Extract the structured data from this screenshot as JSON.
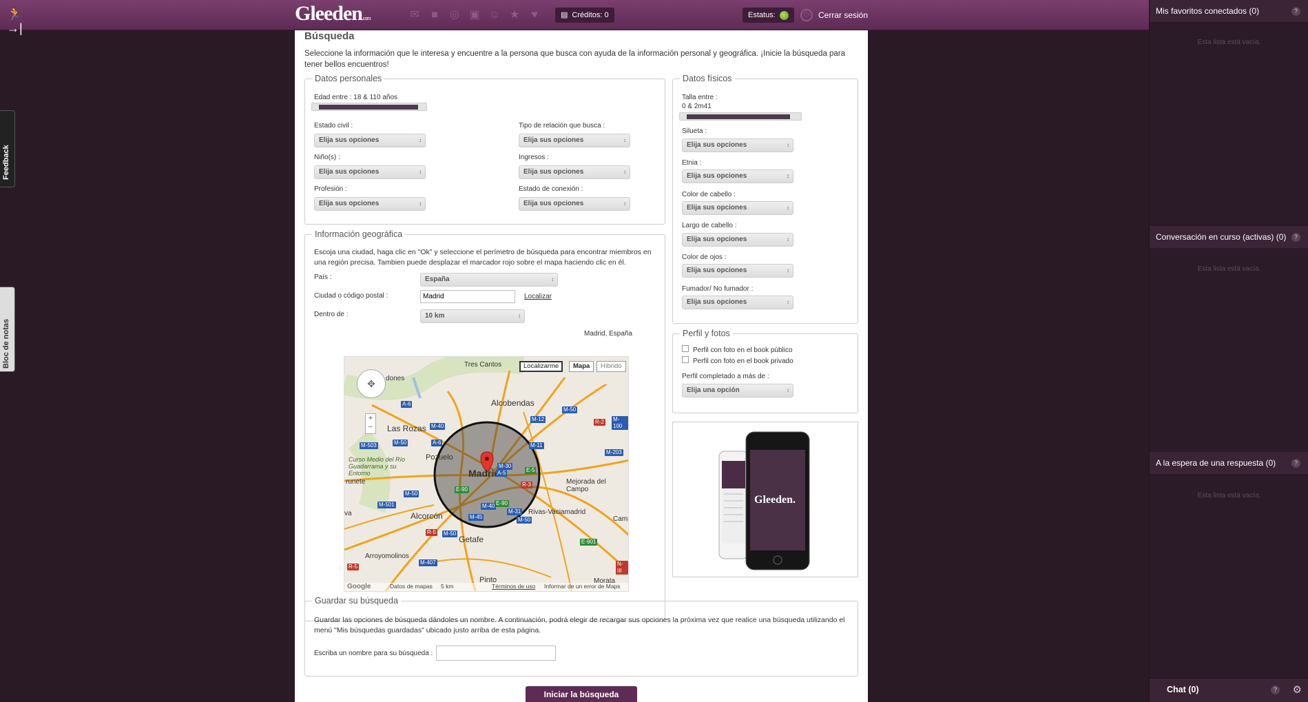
{
  "topbar": {
    "logo": "Gleeden",
    "logo_suffix": ".com",
    "credits_label": "Créditos: 0",
    "status_label": "Estatus:",
    "logout_label": "Cerrar sesión",
    "icons": [
      "mail-icon",
      "van-icon",
      "camera-icon",
      "gift-icon",
      "user-icon",
      "star-icon",
      "heart-icon"
    ]
  },
  "sidetabs": {
    "feedback": "Feedback",
    "notes": "Bloc de notas"
  },
  "main": {
    "title": "Búsqueda",
    "intro": "Seleccione la información que le interesa y encuentre a la persona que busca con ayuda de la información personal y geográfica. ¡Inicie la búsqueda para tener bellos encuentros!",
    "personal": {
      "legend": "Datos personales",
      "age_label": "Edad entre : 18 & 110 años",
      "age_range": [
        0.05,
        0.95
      ],
      "fields": [
        {
          "label": "Estado civil :",
          "value": "Elija sus opciones"
        },
        {
          "label": "Tipo de relación que busca :",
          "value": "Elija sus opciones"
        },
        {
          "label": "Niño(s) :",
          "value": "Elija sus opciones"
        },
        {
          "label": "Ingresos :",
          "value": "Elija sus opciones"
        },
        {
          "label": "Profesión :",
          "value": "Elija sus opciones"
        },
        {
          "label": "Estado de conexión :",
          "value": "Elija sus opciones"
        }
      ]
    },
    "geo": {
      "legend": "Información geográfica",
      "description": "Escoja una ciudad, haga clic en \"Ok\" y seleccione el perímetro de búsqueda para encontrar miembros en una región precisa. Tambien puede desplazar el marcador rojo sobre el mapa haciendo clic en él.",
      "country_label": "País :",
      "country_value": "España",
      "city_label": "Ciudad o código postal :",
      "city_value": "Madrid",
      "locate_link": "Localizar",
      "within_label": "Dentro de :",
      "within_value": "10 km",
      "location_text": "Madrid, España",
      "map": {
        "btn_locate": "Localizarme",
        "btn_map": "Mapa",
        "btn_hybrid": "Híbrido",
        "zoom_in": "+",
        "zoom_out": "−",
        "labels": [
          "Tres Cantos",
          "Alcobendas",
          "Las Rozas",
          "Pozuelo",
          "Madrid",
          "Alcorcón",
          "Getafe",
          "Mejorada del Campo",
          "Rivas-Vaciamadrid",
          "Arroyomolinos",
          "Pinto",
          "Morata",
          "Curso Medio del Río Guadarrama y su Entorno",
          "runete",
          "Camp",
          "va",
          "dones"
        ],
        "road_labels": [
          "A-6",
          "M-40",
          "M-12",
          "M-50",
          "R-2",
          "M-100",
          "M-503",
          "M-50",
          "A-6",
          "M-11",
          "M-203",
          "M-30",
          "E-5",
          "E-90",
          "M-50",
          "M-501",
          "E-90",
          "M-40",
          "M-31",
          "M-45",
          "M-50",
          "R-5",
          "M-50",
          "E-901",
          "M-407",
          "R-5",
          "N-III",
          "A-5",
          "R-3"
        ],
        "footer_data": "Datos de mapas",
        "footer_scale": "5 km",
        "footer_terms": "Términos de uso",
        "footer_report": "Informar de un error de Maps",
        "google": "Google"
      }
    },
    "physical": {
      "legend": "Datos físicos",
      "height_label": "Talla entre :",
      "height_value": "0 & 2m41",
      "height_range": [
        0.05,
        0.95
      ],
      "fields": [
        {
          "label": "Silueta :",
          "value": "Elija sus opciones"
        },
        {
          "label": "Etnia :",
          "value": "Elija sus opciones"
        },
        {
          "label": "Color de cabello :",
          "value": "Elija sus opciones"
        },
        {
          "label": "Largo de cabello :",
          "value": "Elija sus opciones"
        },
        {
          "label": "Color de ojos :",
          "value": "Elija sus opciones"
        },
        {
          "label": "Fumador/ No fumador :",
          "value": "Elija sus opciones"
        }
      ]
    },
    "profile": {
      "legend": "Perfil y fotos",
      "check_public": "Perfil con foto en el book público",
      "check_private": "Perfil con foto en el book privado",
      "completed_label": "Perfil completado a más de :",
      "completed_value": "Elija una opción"
    },
    "ad": {
      "brand": "Gleeden."
    },
    "save": {
      "legend": "Guardar su búsqueda",
      "description": "Guardar las opciones de búsqueda dándoles un nombre. A continuación, podrá elegir de recargar sus opciones la próxima vez que realice una búsqueda utilizando el menú \"Mis búsquedas guardadas\" ubicado justo arriba de esta página.",
      "name_label": "Escriba un nombre para su búsqueda :",
      "name_value": ""
    },
    "search_button": "Iniciar la búsqueda"
  },
  "rightcol": {
    "favorites": "Mis favoritos conectados (0)",
    "conversations": "Conversación en curso (activas) (0)",
    "waiting": "A la espera de una respuesta (0)",
    "empty": "Esta lista está vacía.",
    "help": "?",
    "chat": "Chat (0)"
  }
}
